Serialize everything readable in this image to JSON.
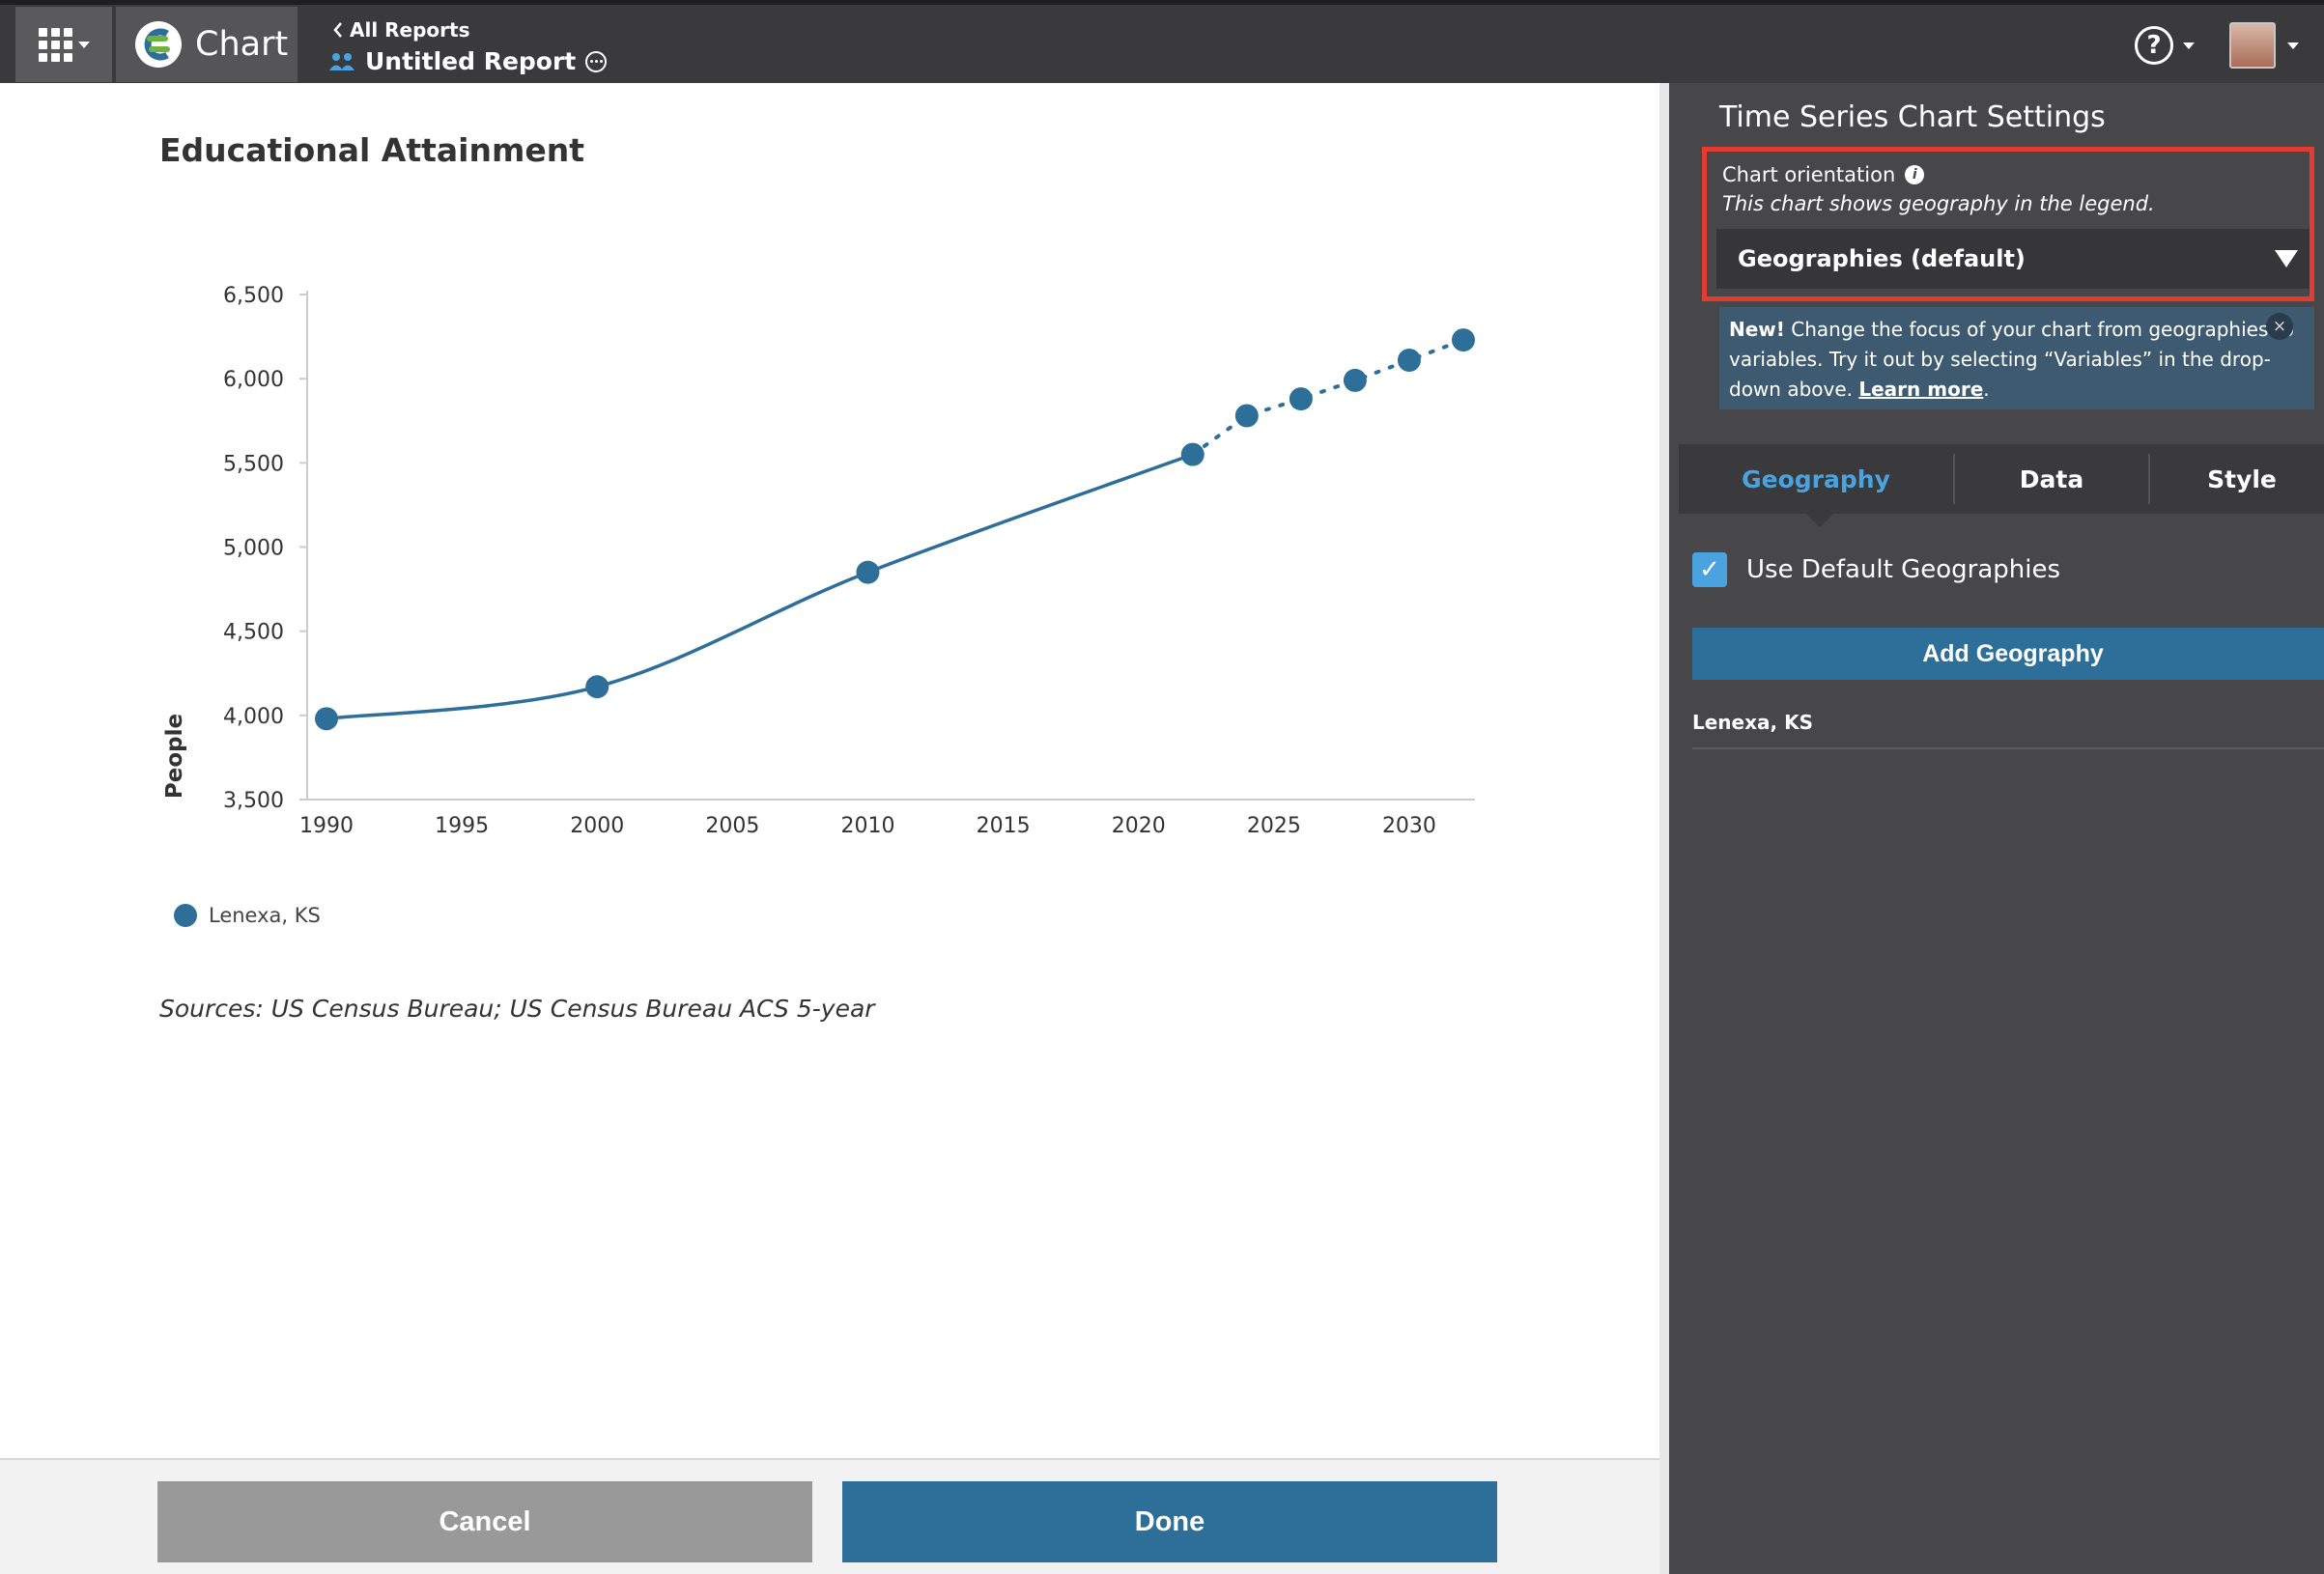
{
  "header": {
    "product_name": "Chart",
    "back_link": "All Reports",
    "report_title": "Untitled Report",
    "help_symbol": "?"
  },
  "chart_title": "Educational Attainment",
  "chart_data": {
    "type": "line",
    "title": "Educational Attainment",
    "xlabel": "",
    "ylabel": "People",
    "xlim": [
      1990,
      2032
    ],
    "ylim": [
      3500,
      6500
    ],
    "x_ticks": [
      1990,
      1995,
      2000,
      2005,
      2010,
      2015,
      2020,
      2025,
      2030
    ],
    "y_ticks": [
      3500,
      4000,
      4500,
      5000,
      5500,
      6000,
      6500
    ],
    "y_tick_labels": [
      "3,500",
      "4,000",
      "4,500",
      "5,000",
      "5,500",
      "6,000",
      "6,500"
    ],
    "series": [
      {
        "name": "Lenexa, KS",
        "color": "#2e6f9a",
        "x": [
          1990,
          2000,
          2010,
          2022,
          2024,
          2026,
          2028,
          2030,
          2032
        ],
        "y": [
          3980,
          4170,
          4850,
          5550,
          5780,
          5880,
          5990,
          6110,
          6230
        ],
        "projected_from_index": 3
      }
    ],
    "legend_placement": "bottom-left",
    "grid": false
  },
  "legend": {
    "label": "Lenexa, KS"
  },
  "sources": "Sources: US Census Bureau; US Census Bureau ACS 5-year",
  "footer": {
    "cancel_label": "Cancel",
    "done_label": "Done"
  },
  "panel": {
    "title": "Time Series Chart Settings",
    "orientation_label": "Chart orientation",
    "orientation_sub": "This chart shows geography in the legend.",
    "orientation_value": "Geographies (default)",
    "notice_new": "New!",
    "notice_text": " Change the focus of your chart from geographies to variables. Try it out by selecting “Variables” in the drop-down above. ",
    "notice_link": "Learn more",
    "notice_end": ".",
    "tabs": [
      {
        "label": "Geography",
        "active": true
      },
      {
        "label": "Data",
        "active": false
      },
      {
        "label": "Style",
        "active": false
      }
    ],
    "use_default_label": "Use Default Geographies",
    "add_geography_label": "Add Geography",
    "geographies": [
      "Lenexa, KS"
    ]
  },
  "colors": {
    "accent": "#2e6f9a",
    "tab_active": "#4aa3df",
    "highlight_border": "#e53b2e"
  }
}
